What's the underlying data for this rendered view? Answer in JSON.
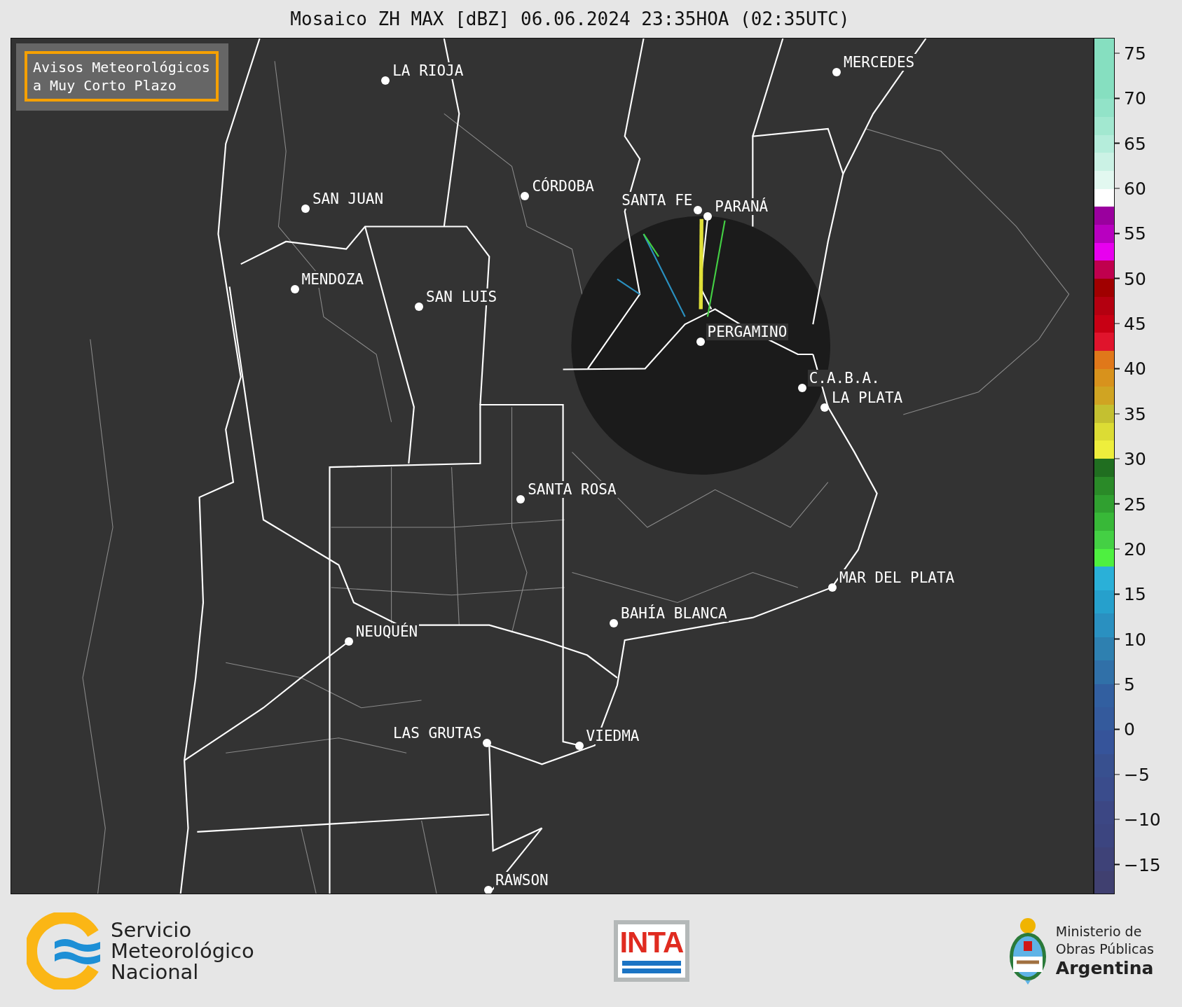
{
  "title": "Mosaico ZH MAX [dBZ] 06.06.2024 23:35HOA (02:35UTC)",
  "notice": {
    "lines": [
      "Avisos Meteorológicos",
      "a Muy Corto Plazo"
    ]
  },
  "cities": [
    {
      "name": "LA RIOJA"
    },
    {
      "name": "MERCEDES"
    },
    {
      "name": "CÓRDOBA"
    },
    {
      "name": "SAN JUAN"
    },
    {
      "name": "SANTA FE"
    },
    {
      "name": "PARANÁ"
    },
    {
      "name": "MENDOZA"
    },
    {
      "name": "SAN LUIS"
    },
    {
      "name": "PERGAMINO"
    },
    {
      "name": "C.A.B.A."
    },
    {
      "name": "LA PLATA"
    },
    {
      "name": "SANTA ROSA"
    },
    {
      "name": "MAR DEL PLATA"
    },
    {
      "name": "BAHÍA BLANCA"
    },
    {
      "name": "NEUQUÉN"
    },
    {
      "name": "LAS GRUTAS"
    },
    {
      "name": "VIEDMA"
    },
    {
      "name": "RAWSON"
    }
  ],
  "colorbar": {
    "ticks": [
      "75",
      "70",
      "65",
      "60",
      "55",
      "50",
      "45",
      "40",
      "35",
      "30",
      "25",
      "20",
      "15",
      "10",
      "5",
      "0",
      "−5",
      "−10",
      "−15"
    ]
  },
  "footer": {
    "smn": {
      "lines": [
        "Servicio",
        "Meteorológico",
        "Nacional"
      ]
    },
    "inta": {
      "text": "INTA"
    },
    "ministry": {
      "lines": [
        "Ministerio de",
        "Obras Públicas",
        "Argentina"
      ]
    }
  }
}
